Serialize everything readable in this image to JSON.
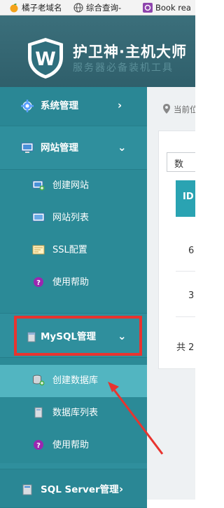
{
  "bookmarks": [
    {
      "label": "橘子老域名",
      "icon": "orange-fruit-icon"
    },
    {
      "label": "综合查询-",
      "icon": "globe-icon"
    },
    {
      "label": "Book rea",
      "icon": "book-icon"
    }
  ],
  "header": {
    "title": "护卫神·主机大师",
    "subtitle": "服务器必备装机工具",
    "logo": "shield-w-logo"
  },
  "sidebar": {
    "sections": [
      {
        "label": "系统管理",
        "icon": "gear-icon",
        "chevron": "›"
      },
      {
        "label": "网站管理",
        "icon": "monitor-icon",
        "chevron": "⌄"
      },
      {
        "label": "MySQL管理",
        "icon": "database-icon",
        "chevron": "⌄"
      },
      {
        "label": "SQL Server管理",
        "icon": "server-icon",
        "chevron": "›"
      }
    ],
    "website_items": [
      {
        "label": "创建网站",
        "icon": "add-site-icon"
      },
      {
        "label": "网站列表",
        "icon": "site-list-icon"
      },
      {
        "label": "SSL配置",
        "icon": "certificate-icon"
      },
      {
        "label": "使用帮助",
        "icon": "help-icon"
      }
    ],
    "mysql_items": [
      {
        "label": "创建数据库",
        "icon": "add-database-icon",
        "active": true
      },
      {
        "label": "数据库列表",
        "icon": "database-list-icon"
      },
      {
        "label": "使用帮助",
        "icon": "help-icon"
      }
    ]
  },
  "main": {
    "breadcrumb": "当前位",
    "select_value": "数",
    "table_header": "ID",
    "rows": [
      "6",
      "3"
    ],
    "pagination": "共 2"
  },
  "colors": {
    "sidebar": "#2f8f9d",
    "sidebar_active": "#4db3bf",
    "header": "#35666f",
    "table_header": "#2aa3b2",
    "highlight": "#e8342f"
  }
}
